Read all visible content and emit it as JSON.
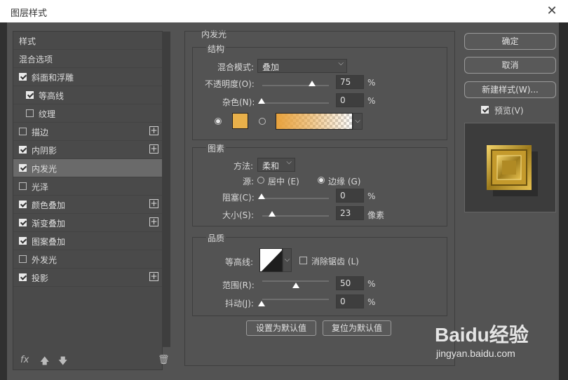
{
  "window": {
    "title": "图层样式"
  },
  "styles_list": {
    "items": [
      {
        "label": "样式",
        "checkbox": false,
        "checked": false,
        "plus": false,
        "indent": 0,
        "selected": false
      },
      {
        "label": "混合选项",
        "checkbox": false,
        "checked": false,
        "plus": false,
        "indent": 0,
        "selected": false
      },
      {
        "label": "斜面和浮雕",
        "checkbox": true,
        "checked": true,
        "plus": false,
        "indent": 0,
        "selected": false
      },
      {
        "label": "等高线",
        "checkbox": true,
        "checked": true,
        "plus": false,
        "indent": 1,
        "selected": false
      },
      {
        "label": "纹理",
        "checkbox": true,
        "checked": false,
        "plus": false,
        "indent": 1,
        "selected": false
      },
      {
        "label": "描边",
        "checkbox": true,
        "checked": false,
        "plus": true,
        "indent": 0,
        "selected": false
      },
      {
        "label": "内阴影",
        "checkbox": true,
        "checked": true,
        "plus": true,
        "indent": 0,
        "selected": false
      },
      {
        "label": "内发光",
        "checkbox": true,
        "checked": true,
        "plus": false,
        "indent": 0,
        "selected": true
      },
      {
        "label": "光泽",
        "checkbox": true,
        "checked": false,
        "plus": false,
        "indent": 0,
        "selected": false
      },
      {
        "label": "颜色叠加",
        "checkbox": true,
        "checked": true,
        "plus": true,
        "indent": 0,
        "selected": false
      },
      {
        "label": "渐变叠加",
        "checkbox": true,
        "checked": true,
        "plus": true,
        "indent": 0,
        "selected": false
      },
      {
        "label": "图案叠加",
        "checkbox": true,
        "checked": true,
        "plus": false,
        "indent": 0,
        "selected": false
      },
      {
        "label": "外发光",
        "checkbox": true,
        "checked": false,
        "plus": false,
        "indent": 0,
        "selected": false
      },
      {
        "label": "投影",
        "checkbox": true,
        "checked": true,
        "plus": true,
        "indent": 0,
        "selected": false
      }
    ],
    "footer": {
      "fx": "fx",
      "up_icon": "arrow-up-icon",
      "down_icon": "arrow-down-icon",
      "trash_icon": "trash-icon"
    }
  },
  "inner_glow": {
    "panel_title": "内发光",
    "structure": {
      "title": "结构",
      "blend_mode_label": "混合模式:",
      "blend_mode_value": "叠加",
      "opacity_label": "不透明度(O):",
      "opacity_value": "75",
      "opacity_unit": "%",
      "noise_label": "杂色(N):",
      "noise_value": "0",
      "noise_unit": "%",
      "color_swatch": "#e8b04a",
      "gradient_start": "#e8a23c"
    },
    "elements": {
      "title": "图素",
      "method_label": "方法:",
      "method_value": "柔和",
      "source_label": "源:",
      "source_center": "居中 (E)",
      "source_edge": "边缘 (G)",
      "choke_label": "阻塞(C):",
      "choke_value": "0",
      "choke_unit": "%",
      "size_label": "大小(S):",
      "size_value": "23",
      "size_unit": "像素"
    },
    "quality": {
      "title": "品质",
      "contour_label": "等高线:",
      "antialias_label": "消除锯齿 (L)",
      "range_label": "范围(R):",
      "range_value": "50",
      "range_unit": "%",
      "jitter_label": "抖动(J):",
      "jitter_value": "0",
      "jitter_unit": "%"
    },
    "make_default": "设置为默认值",
    "reset_default": "复位为默认值"
  },
  "actions": {
    "ok": "确定",
    "cancel": "取消",
    "new_style": "新建样式(W)...",
    "preview_label": "预览(V)"
  },
  "watermark": {
    "line1": "Baidu经验",
    "line2": "jingyan.baidu.com"
  }
}
